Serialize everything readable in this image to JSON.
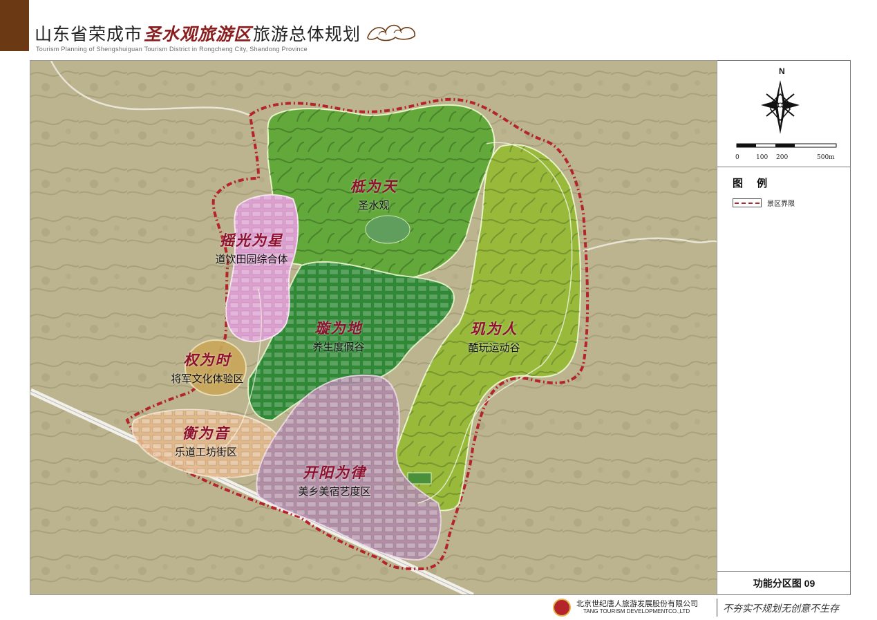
{
  "header": {
    "title_prefix": "山东省荣成市",
    "title_brush": "圣水观旅游区",
    "title_suffix": "旅游总体规划",
    "subtitle_en": "Tourism Planning of Shengshuiguan Tourism District in Rongcheng City, Shandong Province"
  },
  "zones": [
    {
      "art": "柢为天",
      "name": "圣水观",
      "color": "#63a83a"
    },
    {
      "art": "摇光为星",
      "name": "道饮田园综合体",
      "color": "#dc9fd0"
    },
    {
      "art": "璇为地",
      "name": "养生度假谷",
      "color": "#2f8a36"
    },
    {
      "art": "玑为人",
      "name": "酷玩运动谷",
      "color": "#98b93a"
    },
    {
      "art": "权为时",
      "name": "将军文化体验区",
      "color": "#c9a85a"
    },
    {
      "art": "衡为音",
      "name": "乐道工坊街区",
      "color": "#e6b98a"
    },
    {
      "art": "开阳为律",
      "name": "美乡美宿艺度区",
      "color": "#b08aa8"
    }
  ],
  "compass": {
    "north_label": "N"
  },
  "scale_bar": {
    "ticks": [
      "0",
      "100",
      "200",
      "500m"
    ]
  },
  "legend": {
    "title": "图 例",
    "items": [
      {
        "label": "景区界限",
        "line_color": "#b3242b"
      }
    ]
  },
  "map_title": "功能分区图 09",
  "footer": {
    "company_cn": "北京世纪唐人旅游发展股份有限公司",
    "company_en": "TANG TOURISM DEVELOPMENTCO.,LTD",
    "slogan": "不夯实不规划无创意不生存"
  }
}
